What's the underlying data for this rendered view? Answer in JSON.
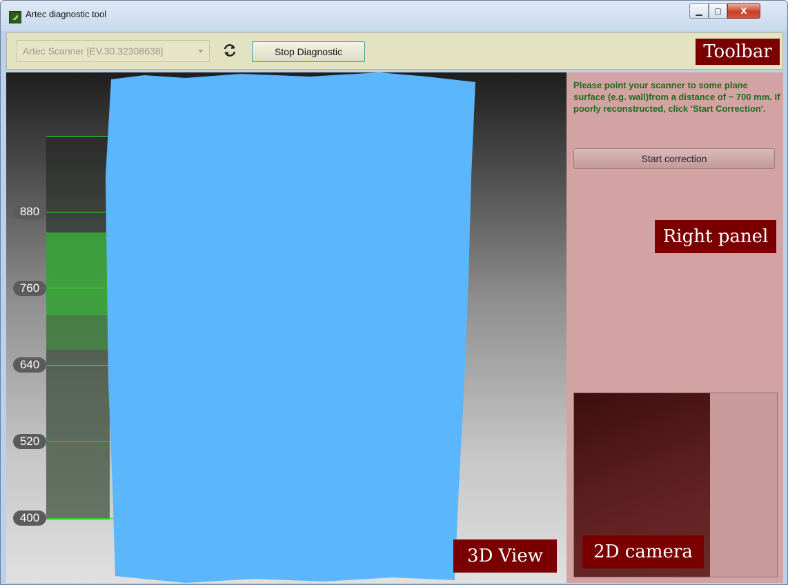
{
  "window": {
    "title": "Artec diagnostic tool",
    "controls": {
      "minimize": "▁",
      "maximize": "▢",
      "close": "X"
    }
  },
  "toolbar": {
    "device": "Artec Scanner [EV.30.32308638]",
    "refresh_icon": "refresh-icon",
    "stop_label": "Stop Diagnostic",
    "label": "Toolbar"
  },
  "view3d": {
    "label": "3D View",
    "scale_ticks": [
      "880",
      "760",
      "640",
      "520",
      "400"
    ],
    "colors": {
      "cloud": "#5bb6fb",
      "scale_line": "#27e027",
      "label_bg": "#7a0000"
    }
  },
  "right_panel": {
    "instructions": "Please point your scanner to some plane surface (e.g. wall)from a distance of ~ 700 mm. If poorly reconstructed, click 'Start Correction'.",
    "correction_button": "Start correction",
    "label": "Right panel",
    "camera_label": "2D camera"
  }
}
